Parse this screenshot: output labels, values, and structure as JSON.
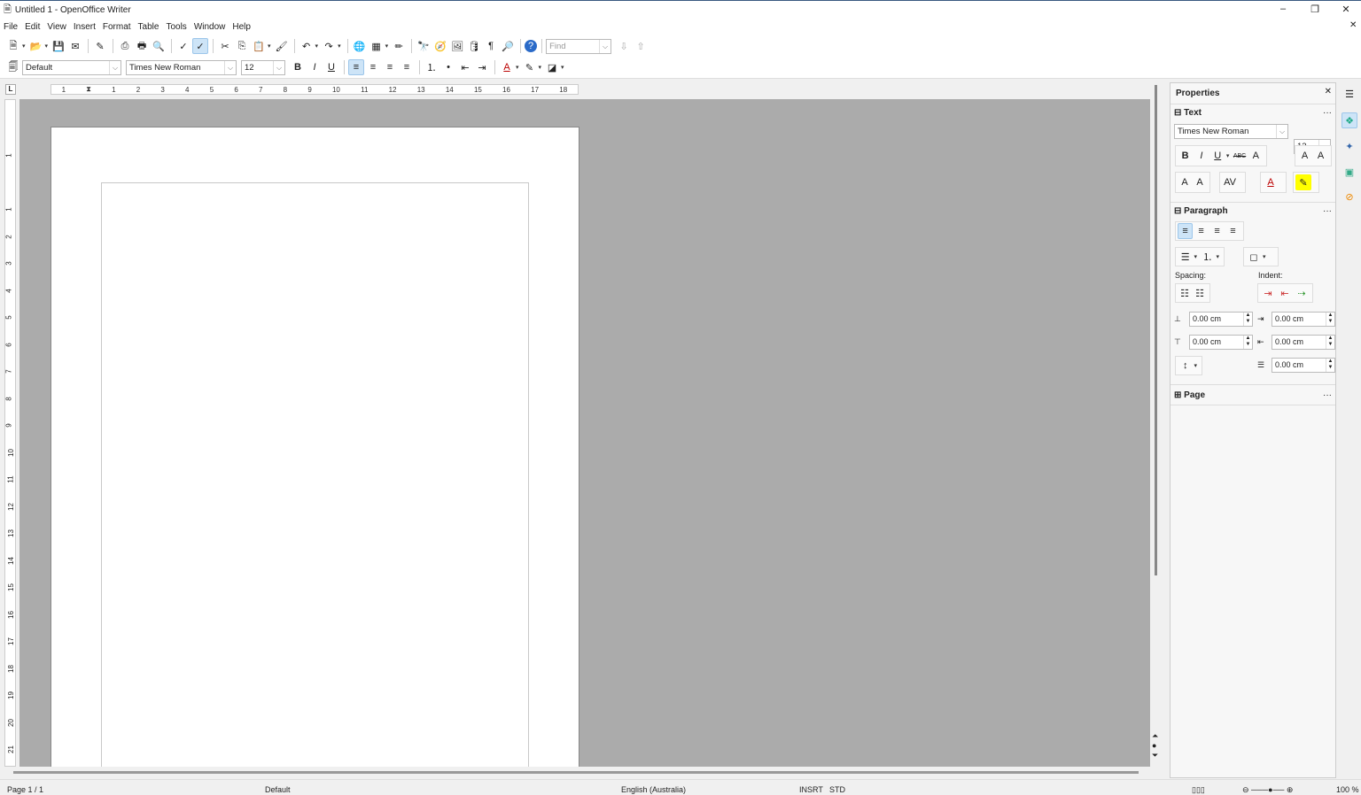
{
  "window": {
    "title": "Untitled 1 - OpenOffice Writer",
    "minimize": "–",
    "restore": "❐",
    "close": "✕",
    "doc_close": "✕"
  },
  "menu": [
    "File",
    "Edit",
    "View",
    "Insert",
    "Format",
    "Table",
    "Tools",
    "Window",
    "Help"
  ],
  "toolbar1": [
    {
      "name": "new",
      "g": "🗎",
      "dd": true
    },
    {
      "name": "open",
      "g": "📂",
      "dd": true
    },
    {
      "name": "save",
      "g": "💾"
    },
    {
      "name": "email",
      "g": "✉"
    },
    {
      "sep": true
    },
    {
      "name": "edit-file",
      "g": "✎"
    },
    {
      "sep": true
    },
    {
      "name": "export-pdf",
      "g": "⎙"
    },
    {
      "name": "print",
      "g": "🖶"
    },
    {
      "name": "page-preview",
      "g": "🔍"
    },
    {
      "sep": true
    },
    {
      "name": "spellcheck",
      "g": "✓"
    },
    {
      "name": "autospellcheck",
      "g": "✓",
      "on": true
    },
    {
      "sep": true
    },
    {
      "name": "cut",
      "g": "✂"
    },
    {
      "name": "copy",
      "g": "⎘"
    },
    {
      "name": "paste",
      "g": "📋",
      "dd": true
    },
    {
      "name": "format-paintbrush",
      "g": "🖌"
    },
    {
      "sep": true
    },
    {
      "name": "undo",
      "g": "↶",
      "dd": true
    },
    {
      "name": "redo",
      "g": "↷",
      "dd": true
    },
    {
      "sep": true
    },
    {
      "name": "hyperlink",
      "g": "🌐"
    },
    {
      "name": "table",
      "g": "▦",
      "dd": true
    },
    {
      "name": "show-draw-functions",
      "g": "✏"
    },
    {
      "sep": true
    },
    {
      "name": "find-replace",
      "g": "🔭"
    },
    {
      "name": "navigator",
      "g": "🧭"
    },
    {
      "name": "gallery",
      "g": "🖼"
    },
    {
      "name": "data-sources",
      "g": "🛢"
    },
    {
      "name": "formatting-marks",
      "g": "¶"
    },
    {
      "name": "zoom",
      "g": "🔎"
    },
    {
      "sep": true
    },
    {
      "name": "help",
      "g": "?"
    }
  ],
  "find": {
    "placeholder": "Find",
    "next": "⇩",
    "prev": "⇧"
  },
  "toolbar2": {
    "style": "Default",
    "font": "Times New Roman",
    "size": "12",
    "buttons": [
      {
        "name": "bold",
        "g": "B"
      },
      {
        "name": "italic",
        "g": "I"
      },
      {
        "name": "underline",
        "g": "U"
      },
      {
        "sep": true
      },
      {
        "name": "align-left",
        "g": "≡",
        "on": true
      },
      {
        "name": "align-center",
        "g": "≡"
      },
      {
        "name": "align-right",
        "g": "≡"
      },
      {
        "name": "justify",
        "g": "≡"
      },
      {
        "sep": true
      },
      {
        "name": "numbering",
        "g": "⒈"
      },
      {
        "name": "bullets",
        "g": "•"
      },
      {
        "name": "decrease-indent",
        "g": "⇤"
      },
      {
        "name": "increase-indent",
        "g": "⇥"
      },
      {
        "sep": true
      },
      {
        "name": "font-color",
        "g": "A",
        "dd": true
      },
      {
        "name": "highlighting",
        "g": "✎",
        "dd": true
      },
      {
        "name": "background-color",
        "g": "◪",
        "dd": true
      }
    ]
  },
  "ruler": {
    "corner": "L",
    "ticks": [
      "1",
      "",
      "1",
      "2",
      "3",
      "4",
      "5",
      "6",
      "7",
      "8",
      "9",
      "10",
      "11",
      "12",
      "13",
      "14",
      "15",
      "16",
      "17",
      "18"
    ],
    "vticks": [
      "1",
      "",
      "1",
      "2",
      "3",
      "4",
      "5",
      "6",
      "7",
      "8",
      "9",
      "10",
      "11",
      "12",
      "13",
      "14",
      "15",
      "16",
      "17",
      "18",
      "19",
      "20",
      "21"
    ]
  },
  "sidebar": {
    "title": "Properties",
    "close": "✕",
    "text": {
      "header": "Text",
      "font": "Times New Roman",
      "size": "12"
    },
    "paragraph": {
      "header": "Paragraph",
      "spacing_label": "Spacing:",
      "indent_label": "Indent:",
      "above": "0.00 cm",
      "below": "0.00 cm",
      "before_text": "0.00 cm",
      "after_text": "0.00 cm",
      "first_line": "0.00 cm"
    },
    "page": {
      "header": "Page"
    },
    "more": "···",
    "collapse": "⊟",
    "expand": "⊞"
  },
  "status": {
    "page": "Page 1 / 1",
    "style": "Default",
    "language": "English (Australia)",
    "mode": "INSRT",
    "selection": "STD",
    "zoom": "100 %",
    "zoom_level": 100
  }
}
